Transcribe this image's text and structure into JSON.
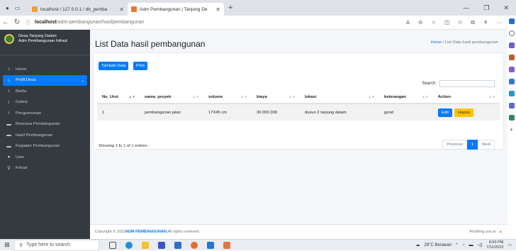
{
  "browser": {
    "tabs": [
      {
        "title": "localhost / 127.0.0.1 / db_pemba"
      },
      {
        "title": "Adm Pembangunan | Tanjung De"
      }
    ],
    "url_host": "localhost",
    "url_path": "/adm-pembangunan/hasilpembangunan"
  },
  "sidebar": {
    "brand_line1": "Desa Tanjung Dalam",
    "brand_line2": "Adm Pembangunan Infrast",
    "items": [
      {
        "label": "Home",
        "icon": "⌂"
      },
      {
        "label": "Profil Desa",
        "icon": "⌂"
      },
      {
        "label": "Berita",
        "icon": "i"
      },
      {
        "label": "Galery",
        "icon": "i"
      },
      {
        "label": "Pengumuman",
        "icon": "i"
      },
      {
        "label": "Rencana Pembangunan",
        "icon": "▬"
      },
      {
        "label": "Hasil Pembangunan",
        "icon": "▬"
      },
      {
        "label": "Kegiatan Pembangunan",
        "icon": "▬"
      },
      {
        "label": "User",
        "icon": "●"
      },
      {
        "label": "Keluar",
        "icon": "⚲"
      }
    ]
  },
  "page": {
    "title": "List Data hasil pembangunan",
    "breadcrumb_home": "Home",
    "breadcrumb_sep": " / ",
    "breadcrumb_current": "List Data hasil pembangunan",
    "btn_add": "Tambah Data",
    "btn_print": "Print",
    "search_label": "Search:"
  },
  "table": {
    "headers": [
      "No_Urut",
      "nama_proyek",
      "volume",
      "biaya",
      "lokasi",
      "keterangan",
      "Action"
    ],
    "rows": [
      {
        "no": "1",
        "nama": "pembangunan jalan",
        "volume": "17X45 cm",
        "biaya": "30.000.000",
        "lokasi": "dusun 2 tanjung dalam",
        "ket": "good",
        "edit": "Edit",
        "hapus": "Hapus"
      }
    ],
    "info": "Showing 1 to 1 of 1 entries",
    "prev": "Previous",
    "page": "1",
    "next": "Next"
  },
  "footer": {
    "copy": "Copyright © 2023 ",
    "brand": "ADM PEMBANGUNAN.",
    "rights": " All rights reserved.",
    "right": "Anything you w"
  },
  "taskbar": {
    "search_placeholder": "Type here to search",
    "weather": "29°C  Berawan",
    "time": "8:50 PM",
    "date": "7/11/2023"
  }
}
